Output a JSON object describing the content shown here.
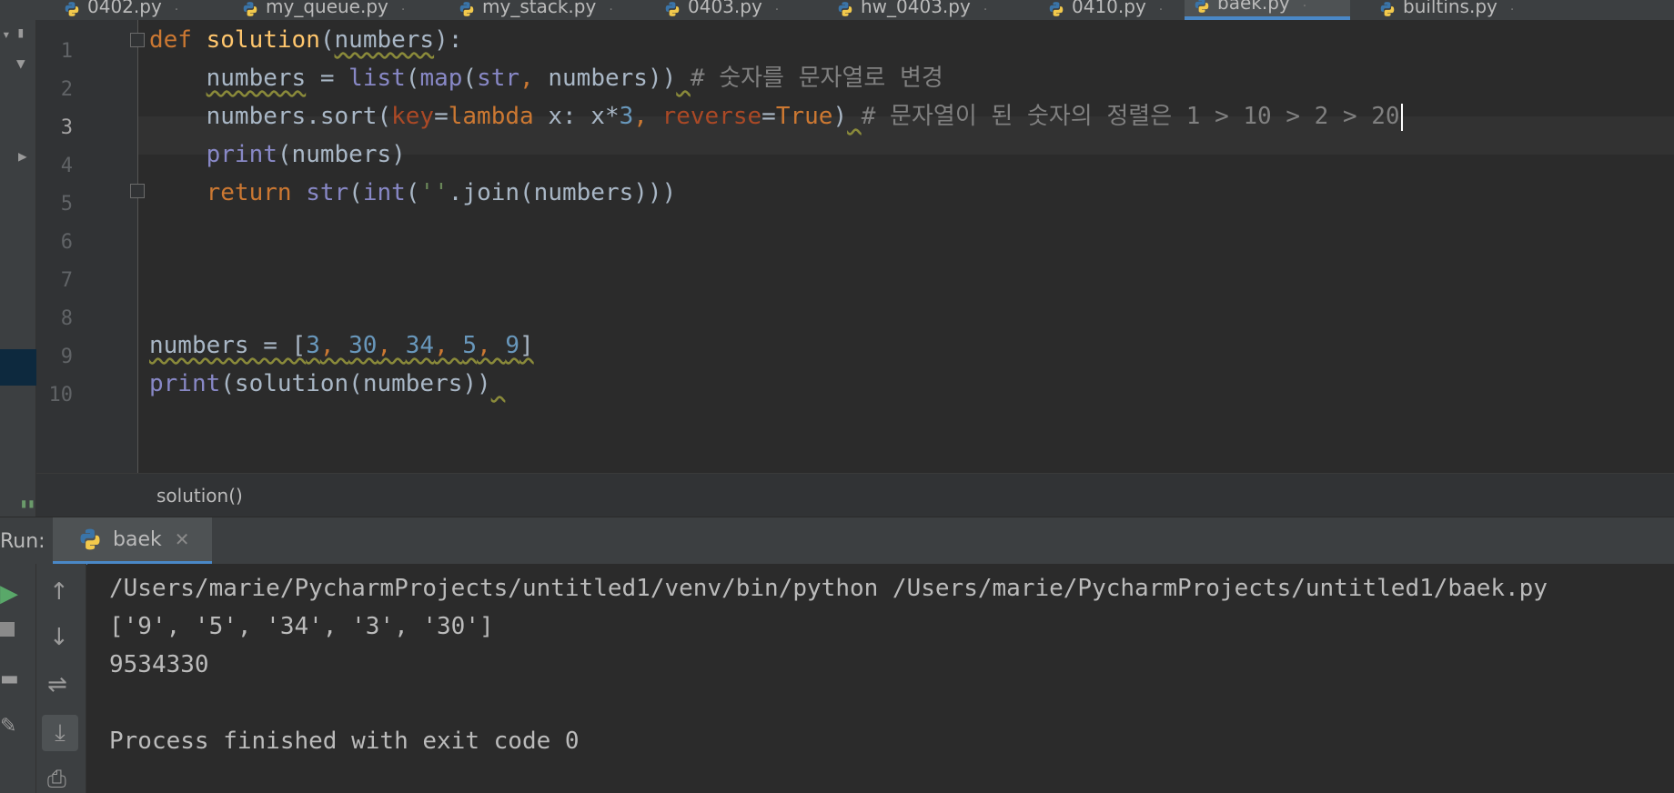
{
  "tabs": [
    {
      "label": "0402.py",
      "left": 0
    },
    {
      "label": "my_queue.py",
      "left": 0
    },
    {
      "label": "my_stack.py",
      "left": 0
    },
    {
      "label": "0403.py",
      "left": 0
    },
    {
      "label": "hw_0403.py",
      "left": 0
    },
    {
      "label": "0410.py",
      "left": 0
    },
    {
      "label": "baek.py",
      "left": 0
    },
    {
      "label": "builtins.py",
      "left": 0
    }
  ],
  "editor": {
    "line_numbers": [
      "1",
      "2",
      "3",
      "4",
      "5",
      "6",
      "7",
      "8",
      "9",
      "10"
    ],
    "current_line": "3",
    "lines": [
      [
        {
          "t": "def ",
          "c": "kw"
        },
        {
          "t": "solution",
          "c": "fn"
        },
        {
          "t": "(",
          "c": "tx"
        },
        {
          "t": "numbers",
          "c": "tx",
          "sq": true
        },
        {
          "t": "):",
          "c": "tx"
        }
      ],
      [
        {
          "t": "    ",
          "c": "tx"
        },
        {
          "t": "numbers",
          "c": "tx",
          "sq": true
        },
        {
          "t": " = ",
          "c": "tx"
        },
        {
          "t": "list",
          "c": "bi"
        },
        {
          "t": "(",
          "c": "tx"
        },
        {
          "t": "map",
          "c": "bi"
        },
        {
          "t": "(",
          "c": "tx"
        },
        {
          "t": "str",
          "c": "bi"
        },
        {
          "t": ", ",
          "c": "kw"
        },
        {
          "t": "numbers",
          "c": "tx"
        },
        {
          "t": "))",
          "c": "tx"
        },
        {
          "t": " ",
          "c": "tx",
          "sq": true
        },
        {
          "t": "# 숫자를 문자열로 변경",
          "c": "cm"
        }
      ],
      [
        {
          "t": "    ",
          "c": "tx"
        },
        {
          "t": "numbers.sort(",
          "c": "tx"
        },
        {
          "t": "key",
          "c": "param"
        },
        {
          "t": "=",
          "c": "tx"
        },
        {
          "t": "lambda ",
          "c": "kw"
        },
        {
          "t": "x: x*",
          "c": "tx"
        },
        {
          "t": "3",
          "c": "num"
        },
        {
          "t": ", ",
          "c": "kw"
        },
        {
          "t": "reverse",
          "c": "param"
        },
        {
          "t": "=",
          "c": "tx"
        },
        {
          "t": "True",
          "c": "kw"
        },
        {
          "t": ")",
          "c": "tx"
        },
        {
          "t": " ",
          "c": "tx",
          "sq": true
        },
        {
          "t": "# 문자열이 된 숫자의 정렬은 1 > 10 > 2 > 20",
          "c": "cm"
        }
      ],
      [
        {
          "t": "    ",
          "c": "tx"
        },
        {
          "t": "print",
          "c": "bi"
        },
        {
          "t": "(numbers)",
          "c": "tx"
        }
      ],
      [
        {
          "t": "    ",
          "c": "tx"
        },
        {
          "t": "return ",
          "c": "kw"
        },
        {
          "t": "str",
          "c": "bi"
        },
        {
          "t": "(",
          "c": "tx"
        },
        {
          "t": "int",
          "c": "bi"
        },
        {
          "t": "(",
          "c": "tx"
        },
        {
          "t": "''",
          "c": "str"
        },
        {
          "t": ".join(numbers)))",
          "c": "tx"
        }
      ],
      [],
      [],
      [],
      [
        {
          "t": "numbers = [",
          "c": "tx",
          "sq": true
        },
        {
          "t": "3",
          "c": "num",
          "sq": true
        },
        {
          "t": ", ",
          "c": "kw",
          "sq": true
        },
        {
          "t": "30",
          "c": "num",
          "sq": true
        },
        {
          "t": ", ",
          "c": "kw",
          "sq": true
        },
        {
          "t": "34",
          "c": "num",
          "sq": true
        },
        {
          "t": ", ",
          "c": "kw",
          "sq": true
        },
        {
          "t": "5",
          "c": "num",
          "sq": true
        },
        {
          "t": ", ",
          "c": "kw",
          "sq": true
        },
        {
          "t": "9",
          "c": "num",
          "sq": true
        },
        {
          "t": "]",
          "c": "tx",
          "sq": true
        }
      ],
      [
        {
          "t": "print",
          "c": "bi"
        },
        {
          "t": "(solution(numbers))",
          "c": "tx"
        },
        {
          "t": " ",
          "c": "tx",
          "sq": true
        }
      ]
    ]
  },
  "breadcrumb": "solution()",
  "run": {
    "label": "Run:",
    "tab_label": "baek",
    "close_glyph": "✕",
    "output": [
      "/Users/marie/PycharmProjects/untitled1/venv/bin/python /Users/marie/PycharmProjects/untitled1/baek.py",
      "['9', '5', '34', '3', '30']",
      "9534330",
      "",
      "Process finished with exit code 0"
    ]
  },
  "colors": {
    "accent": "#4a88c7",
    "keyword": "#cc7832",
    "function": "#ffc66d",
    "builtin": "#8888c6",
    "number": "#6897bb",
    "comment": "#808080"
  }
}
